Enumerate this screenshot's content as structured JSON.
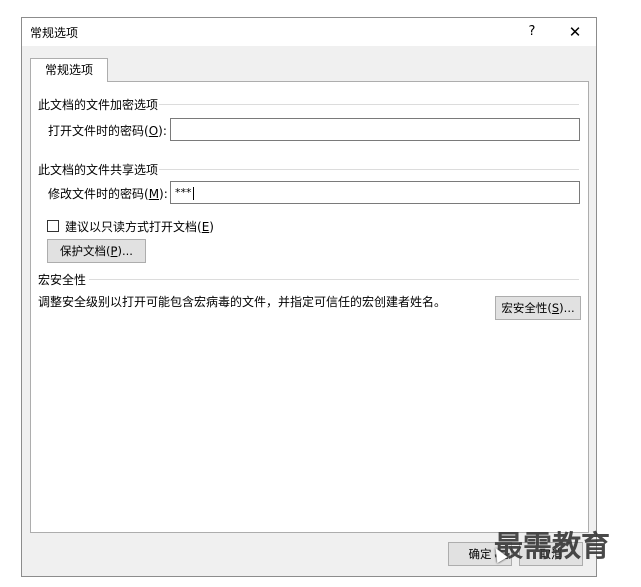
{
  "window": {
    "title": "常规选项",
    "help_label": "?",
    "close_label": "✕"
  },
  "tab": {
    "label": "常规选项"
  },
  "encrypt": {
    "group_title": "此文档的文件加密选项",
    "open_password_label": "打开文件时的密码(",
    "open_password_key": "O",
    "open_password_suffix": "):",
    "open_password_value": ""
  },
  "share": {
    "group_title": "此文档的文件共享选项",
    "modify_password_label": "修改文件时的密码(",
    "modify_password_key": "M",
    "modify_password_suffix": "):",
    "modify_password_value": "***",
    "readonly_label": "建议以只读方式打开文档(",
    "readonly_key": "E",
    "readonly_suffix": ")",
    "readonly_checked": false,
    "protect_button_label": "保护文档(",
    "protect_button_key": "P",
    "protect_button_suffix": ")..."
  },
  "macro": {
    "group_title": "宏安全性",
    "description": "调整安全级别以打开可能包含宏病毒的文件，并指定可信任的宏创建者姓名。",
    "button_label": "宏安全性(",
    "button_key": "S",
    "button_suffix": ")..."
  },
  "footer": {
    "ok_label": "确定",
    "cancel_label": "取消"
  },
  "watermark": {
    "text": "最需教育"
  }
}
